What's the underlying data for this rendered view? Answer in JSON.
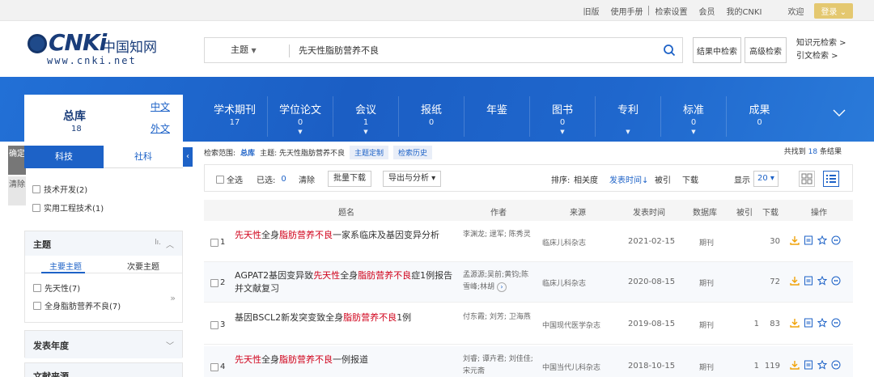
{
  "topbar": {
    "links": [
      "旧版",
      "使用手册",
      "检索设置",
      "会员",
      "我的CNKI",
      "欢迎"
    ],
    "login": "登录"
  },
  "logo": {
    "brand": "CNKi",
    "cn": "中国知网",
    "url": "www.cnki.net"
  },
  "search": {
    "field": "主题",
    "query": "先天性脂肪营养不良",
    "btn_in_results": "结果中检索",
    "btn_advanced": "高级检索",
    "link_knowledge": "知识元检索 >",
    "link_citation": "引文检索 >"
  },
  "library": {
    "name": "总库",
    "count": "18",
    "zh": "中文",
    "wai": "外文"
  },
  "tabs": [
    {
      "label": "学术期刊",
      "count": "17",
      "arrow": ""
    },
    {
      "label": "学位论文",
      "count": "0",
      "arrow": "▼"
    },
    {
      "label": "会议",
      "count": "1",
      "arrow": "▼"
    },
    {
      "label": "报纸",
      "count": "0",
      "arrow": ""
    },
    {
      "label": "年鉴",
      "count": "",
      "arrow": ""
    },
    {
      "label": "图书",
      "count": "0",
      "arrow": "▼"
    },
    {
      "label": "专利",
      "count": "",
      "arrow": "▼"
    },
    {
      "label": "标准",
      "count": "0",
      "arrow": "▼"
    },
    {
      "label": "成果",
      "count": "0",
      "arrow": ""
    }
  ],
  "sidebar": {
    "confirm": "确定",
    "clear": "清除",
    "tab_tech": "科技",
    "tab_social": "社科",
    "categories": [
      "技术开发(2)",
      "实用工程技术(1)"
    ],
    "topic_panel": {
      "title": "主题",
      "main_topic": "主要主题",
      "sub_topic": "次要主题",
      "items": [
        "先天性(7)",
        "全身脂肪营养不良(7)"
      ]
    },
    "year_panel": "发表年度",
    "source_panel": "文献来源"
  },
  "scope": {
    "label": "检索范围:",
    "lib": "总库",
    "topic": "主题: 先天性脂肪营养不良",
    "btn_custom": "主题定制",
    "btn_history": "检索历史",
    "found_pre": "共找到",
    "found_n": "18",
    "found_post": "条结果"
  },
  "toolbar": {
    "select_all": "全选",
    "selected_label": "已选:",
    "selected_n": "0",
    "clear": "清除",
    "batch": "批量下载",
    "export": "导出与分析 ▾",
    "sort": "排序:",
    "sort_rel": "相关度",
    "sort_date": "发表时间↓",
    "sort_cite": "被引",
    "sort_dl": "下载",
    "show": "显示",
    "show_n": "20 ▾"
  },
  "table": {
    "headers": [
      "题名",
      "作者",
      "来源",
      "发表时间",
      "数据库",
      "被引",
      "下载",
      "操作"
    ],
    "rows": [
      {
        "n": "1",
        "title_parts": [
          [
            "先天性",
            "hl"
          ],
          [
            "全身",
            ""
          ],
          [
            "脂肪营养不良",
            "hl"
          ],
          [
            "一家系临床及基因变异分析",
            ""
          ]
        ],
        "authors": "李渊龙; 逯军; 陈秀灵",
        "source": "临床儿科杂志",
        "date": "2021-02-15",
        "db": "期刊",
        "cite": "",
        "dl": "30"
      },
      {
        "n": "2",
        "title_parts": [
          [
            "AGPAT2基因变异致",
            ""
          ],
          [
            "先天性",
            "hl"
          ],
          [
            "全身",
            ""
          ],
          [
            "脂肪营养不良",
            "hl"
          ],
          [
            "症1例报告并文献复习",
            ""
          ]
        ],
        "authors": "孟源源;吴前;黄钧;陈雪峰;林胡",
        "source": "临床儿科杂志",
        "date": "2020-08-15",
        "db": "期刊",
        "cite": "",
        "dl": "72"
      },
      {
        "n": "3",
        "title_parts": [
          [
            "基因BSCL2新发突变致全身",
            ""
          ],
          [
            "脂肪营养不良",
            "hl"
          ],
          [
            "1例",
            ""
          ]
        ],
        "authors": "付东霞; 刘芳; 卫海燕",
        "source": "中国现代医学杂志",
        "date": "2019-08-15",
        "db": "期刊",
        "cite": "1",
        "dl": "83"
      },
      {
        "n": "4",
        "title_parts": [
          [
            "先天性",
            "hl"
          ],
          [
            "全身",
            ""
          ],
          [
            "脂肪营养不良",
            "hl"
          ],
          [
            "一例报道",
            ""
          ]
        ],
        "authors": "刘睿; 谭卉君; 刘佳佳; 宋元斋",
        "source": "中国当代儿科杂志",
        "date": "2018-10-15",
        "db": "期刊",
        "cite": "1",
        "dl": "119"
      }
    ]
  },
  "colors": {
    "brand_blue": "#1d62c7",
    "highlight_red": "#d0021b",
    "login_gold": "#e4c870",
    "download_orange": "#f0a30a"
  }
}
